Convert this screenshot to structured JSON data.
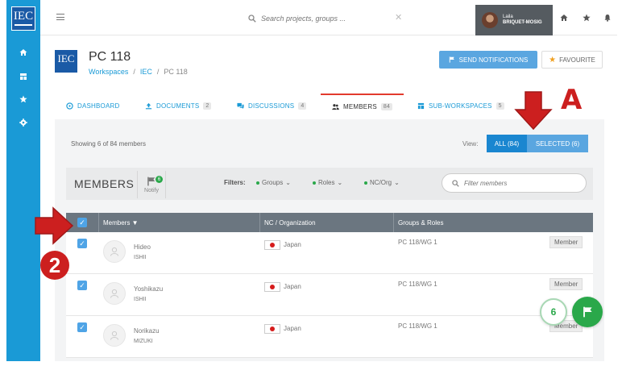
{
  "app": {
    "logo": "IEC",
    "search_placeholder": "Search projects, groups ...",
    "user": {
      "first": "Laila",
      "last": "BRIQUET-MOSIG"
    }
  },
  "workspace": {
    "logo": "IEC",
    "title": "PC 118",
    "breadcrumb": [
      "Workspaces",
      "/",
      "IEC",
      "/",
      "PC 118"
    ],
    "send_notifications": "SEND NOTIFICATIONS",
    "favourite": "FAVOURITE"
  },
  "tabs": [
    {
      "label": "DASHBOARD",
      "count": ""
    },
    {
      "label": "DOCUMENTS",
      "count": "2"
    },
    {
      "label": "DISCUSSIONS",
      "count": "4"
    },
    {
      "label": "MEMBERS",
      "count": "84"
    },
    {
      "label": "SUB-WORKSPACES",
      "count": "5"
    }
  ],
  "members_view": {
    "showing": "Showing 6 of 84 members",
    "view_label": "View:",
    "all": "ALL (84)",
    "selected": "SELECTED (6)",
    "heading": "MEMBERS",
    "notify_badge": "6",
    "notify_label": "Notify",
    "filters_label": "Filters:",
    "filters": [
      "Groups",
      "Roles",
      "NC/Org"
    ],
    "filter_placeholder": "Filter members",
    "columns": [
      "Members ▼",
      "NC / Organization",
      "Groups & Roles"
    ],
    "rows": [
      {
        "first": "Hideo",
        "last": "ISHII",
        "country": "Japan",
        "group": "PC 118/WG 1",
        "role": "Member"
      },
      {
        "first": "Yoshikazu",
        "last": "ISHII",
        "country": "Japan",
        "group": "PC 118/WG 1",
        "role": "Member"
      },
      {
        "first": "Norikazu",
        "last": "MIZUKI",
        "country": "Japan",
        "group": "PC 118/WG 1",
        "role": "Member"
      }
    ],
    "float_count": "6"
  },
  "annotations": {
    "letter": "A",
    "number": "2"
  },
  "colors": {
    "rail": "#1a9ad6",
    "accent": "#5aa6e0",
    "green": "#2aa84a",
    "annotation": "#cc1f1f"
  }
}
